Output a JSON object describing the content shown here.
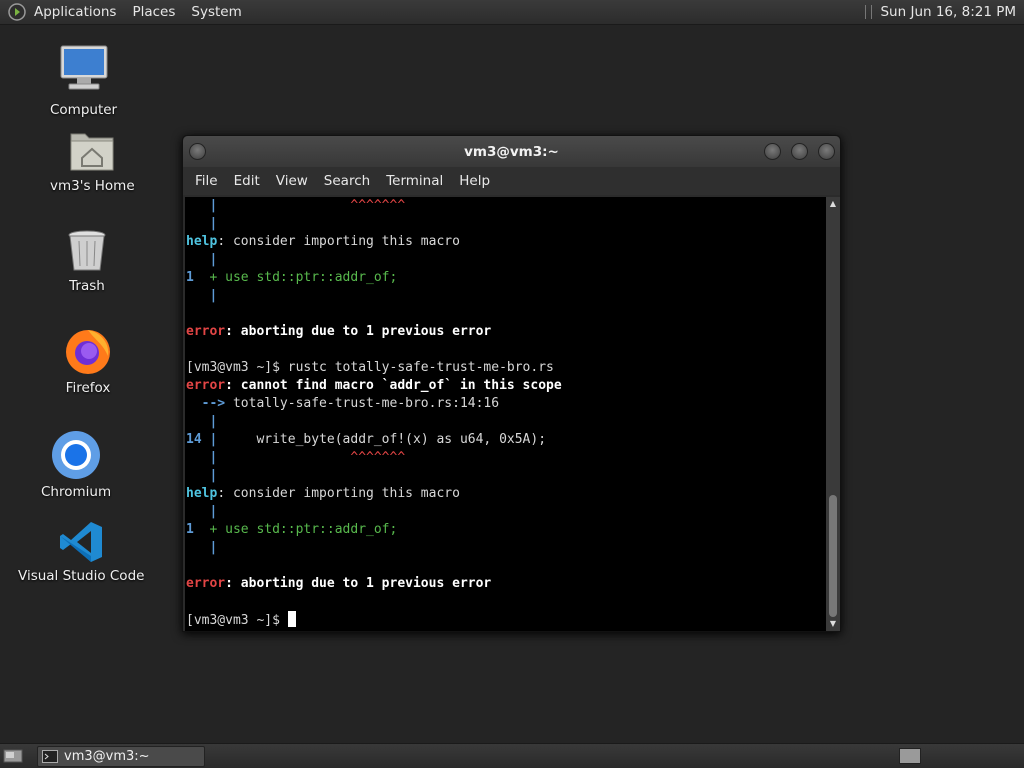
{
  "top_panel": {
    "menus": [
      "Applications",
      "Places",
      "System"
    ],
    "clock": "Sun Jun 16,  8:21 PM"
  },
  "desktop_icons": [
    {
      "label": "Computer",
      "icon": "computer-icon"
    },
    {
      "label": "vm3's Home",
      "icon": "home-folder-icon"
    },
    {
      "label": "Trash",
      "icon": "trash-icon"
    },
    {
      "label": "Firefox",
      "icon": "firefox-icon"
    },
    {
      "label": "Chromium",
      "icon": "chromium-icon"
    },
    {
      "label": "Visual Studio Code",
      "icon": "vscode-icon"
    }
  ],
  "window": {
    "title": "vm3@vm3:~",
    "menu": [
      "File",
      "Edit",
      "View",
      "Search",
      "Terminal",
      "Help"
    ]
  },
  "terminal": {
    "gutter_bar": "|",
    "caret_marks": "^^^^^^^",
    "help_label": "help",
    "help_text": ": consider importing this macro",
    "suggest_num": "1",
    "suggest_plus": "+",
    "suggest_code": "use std::ptr::addr_of;",
    "error_label": "error",
    "abort_text": ": aborting due to 1 previous error",
    "prompt": "[vm3@vm3 ~]$",
    "command": "rustc totally-safe-trust-me-bro.rs",
    "error_msg": ": cannot find macro `addr_of` in this scope",
    "arrow": "-->",
    "location": "totally-safe-trust-me-bro.rs:14:16",
    "line_num": "14",
    "code_line": "write_byte(addr_of!(x) as u64, 0x5A);"
  },
  "taskbar": {
    "task_label": "vm3@vm3:~"
  },
  "colors": {
    "error": "#e24545",
    "help": "#4fc4e0",
    "gutter": "#5e9bd6",
    "suggestion": "#58b94d"
  }
}
